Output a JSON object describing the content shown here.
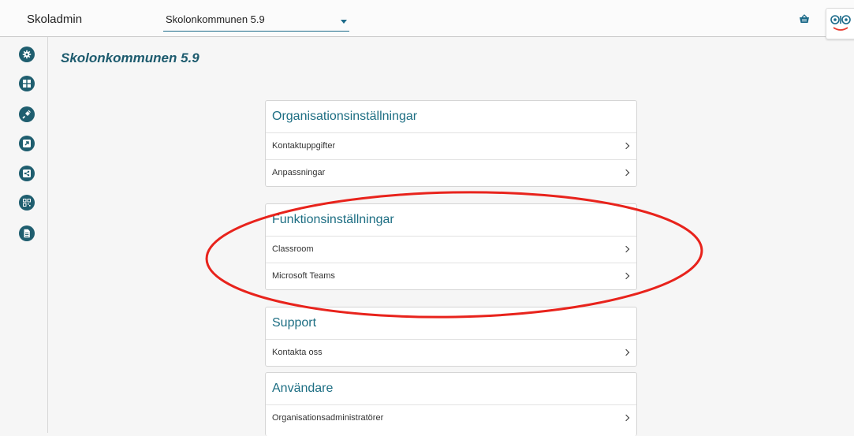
{
  "header": {
    "app_name": "Skoladmin",
    "org_select": {
      "value": "Skolonkommunen 5.9"
    }
  },
  "sidebar": {
    "items": [
      {
        "icon": "gear-icon"
      },
      {
        "icon": "grid-icon"
      },
      {
        "icon": "plug-icon"
      },
      {
        "icon": "external-link-icon"
      },
      {
        "icon": "share-icon"
      },
      {
        "icon": "qr-code-icon"
      },
      {
        "icon": "document-icon"
      }
    ]
  },
  "main": {
    "title": "Skolonkommunen 5.9",
    "sections": [
      {
        "title": "Organisationsinställningar",
        "items": [
          "Kontaktuppgifter",
          "Anpassningar"
        ]
      },
      {
        "title": "Funktionsinställningar",
        "items": [
          "Classroom",
          "Microsoft Teams"
        ]
      },
      {
        "title": "Support",
        "items": [
          "Kontakta oss"
        ]
      },
      {
        "title": "Användare",
        "items": [
          "Organisationsadministratörer"
        ]
      }
    ]
  },
  "colors": {
    "accent": "#1d6e83",
    "rail_button": "#1f5e6f",
    "annotation": "#e8231c"
  }
}
